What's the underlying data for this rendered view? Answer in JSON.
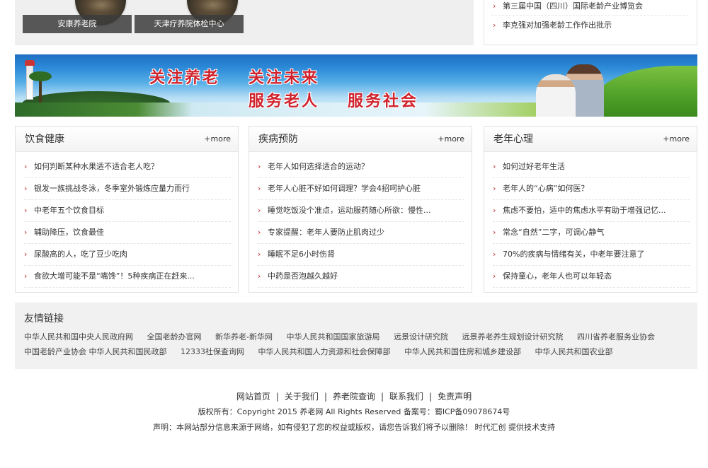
{
  "thumbs": [
    {
      "caption": "安康养老院"
    },
    {
      "caption": "天津疗养院体检中心"
    }
  ],
  "top_news": [
    "第三届中国（四川）国际老龄产业博览会",
    "李克强对加强老龄工作作出批示"
  ],
  "banner": {
    "slogan_1": "关注养老",
    "slogan_2": "关注未来",
    "slogan_3": "服务老人",
    "slogan_4": "服务社会"
  },
  "panels": [
    {
      "title": "饮食健康",
      "more": "+more",
      "items": [
        "如何判断某种水果适不适合老人吃？",
        "银发一族挑战冬泳，冬季室外锻炼应量力而行",
        "中老年五个饮食目标",
        "辅助降压，饮食最佳",
        "尿酸高的人，吃了豆少吃肉",
        "食欲大增可能不是“嘴馋”！5种疾病正在赶来..."
      ]
    },
    {
      "title": "疾病预防",
      "more": "+more",
      "items": [
        "老年人如何选择适合的运动？",
        "老年人心脏不好如何调理？学会4招呵护心脏",
        "睡觉吃饭没个准点，运动服药随心所欲：慢性...",
        "专家提醒：老年人要防止肌肉过少",
        "睡眠不足6小时伤肾",
        "中药是否泡越久越好"
      ]
    },
    {
      "title": "老年心理",
      "more": "+more",
      "items": [
        "如何过好老年生活",
        "老年人的“心病”如何医？",
        "焦虑不要怕，适中的焦虑水平有助于增强记忆...",
        "常念“自然”二字，可调心静气",
        "70%的疾病与情绪有关，中老年要注意了",
        "保持童心，老年人也可以年轻态"
      ]
    }
  ],
  "links": {
    "title": "友情链接",
    "items": [
      "中华人民共和国中央人民政府网",
      "全国老龄办官网",
      "新华养老-新华网",
      "中华人民共和国国家旅游局",
      "远景设计研究院",
      "远景养老养生规划设计研究院",
      "四川省养老服务业协会",
      "中国老龄产业协会",
      "中华人民共和国民政部",
      "12333社保查询网",
      "中华人民共和国人力资源和社会保障部",
      "中华人民共和国住房和城乡建设部",
      "中华人民共和国农业部"
    ]
  },
  "footer": {
    "nav": [
      "网站首页",
      "关于我们",
      "养老院查询",
      "联系我们",
      "免责声明"
    ],
    "separator": "|",
    "copyright": "版权所有：Copyright 2015 养老网 All Rights Reserved 备案号：蜀ICP备09078674号",
    "disclaimer": "声明：本网站部分信息来源于网络，如有侵犯了您的权益或版权，请您告诉我们将予以删除！ 时代汇创 提供技术支持"
  },
  "icons": {
    "arrow": "›"
  },
  "colors": {
    "accent": "#c0282f"
  }
}
